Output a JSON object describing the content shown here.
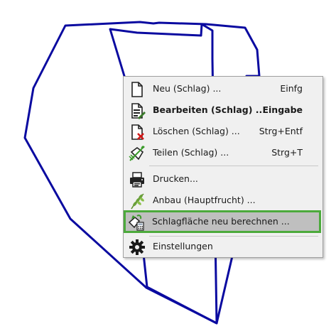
{
  "map": {
    "field_outline_color": "#0a0aa0"
  },
  "context_menu": {
    "highlight_border_color": "#4caa3c",
    "items": [
      {
        "label": "Neu (Schlag) ...",
        "shortcut": "Einfg",
        "icon": "new-document-icon"
      },
      {
        "label": "Bearbeiten (Schlag) ...",
        "shortcut": "Eingabe",
        "icon": "edit-document-icon",
        "bold": true
      },
      {
        "label": "Löschen (Schlag) ...",
        "shortcut": "Strg+Entf",
        "icon": "delete-document-icon"
      },
      {
        "label": "Teilen (Schlag) ...",
        "shortcut": "Strg+T",
        "icon": "split-field-icon"
      },
      {
        "label": "Drucken...",
        "shortcut": "",
        "icon": "printer-icon"
      },
      {
        "label": "Anbau (Hauptfrucht) ...",
        "shortcut": "",
        "icon": "crop-wheat-icon"
      },
      {
        "label": "Schlagfläche neu berechnen ...",
        "shortcut": "",
        "icon": "recalculate-area-icon",
        "highlighted": true
      },
      {
        "label": "Einstellungen",
        "shortcut": "",
        "icon": "gear-icon"
      }
    ]
  }
}
